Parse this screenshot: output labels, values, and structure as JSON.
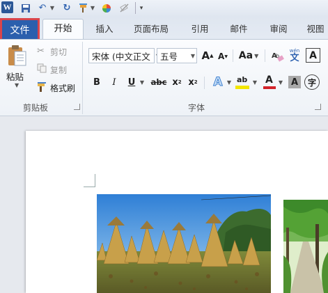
{
  "app": {
    "logo_letter": "W",
    "accent": "#2b5797",
    "file_tab_color": "#2b5fad",
    "highlight_box_color": "#d9454b"
  },
  "quick_access": {
    "icons": [
      "word-icon",
      "save-icon",
      "undo-icon",
      "redo-icon",
      "format-painter-icon",
      "color-icon",
      "eraser-icon",
      "customize-icon"
    ]
  },
  "tabs": {
    "file": "文件",
    "home": "开始",
    "insert": "插入",
    "page_layout": "页面布局",
    "references": "引用",
    "mailings": "邮件",
    "review": "审阅",
    "view": "视图"
  },
  "clipboard": {
    "paste_label": "粘贴",
    "cut_label": "剪切",
    "copy_label": "复制",
    "format_painter_label": "格式刷",
    "group_label": "剪贴板"
  },
  "font": {
    "font_name": "宋体 (中文正文",
    "font_size": "五号",
    "grow_label": "A",
    "shrink_label": "A",
    "change_case_label": "Aa",
    "bold_label": "B",
    "italic_label": "I",
    "underline_label": "U",
    "strike_label": "abc",
    "subscript_label": "x",
    "superscript_label": "x",
    "text_effect_label": "A",
    "highlight_label": "ab",
    "font_color_label": "A",
    "char_shading_label": "A",
    "enclose_label": "字",
    "phonetic_label": "wén",
    "phonetic_char": "文",
    "clear_label": "A",
    "group_label": "字体",
    "highlight_color": "#f3e600",
    "font_color": "#d2232a"
  }
}
